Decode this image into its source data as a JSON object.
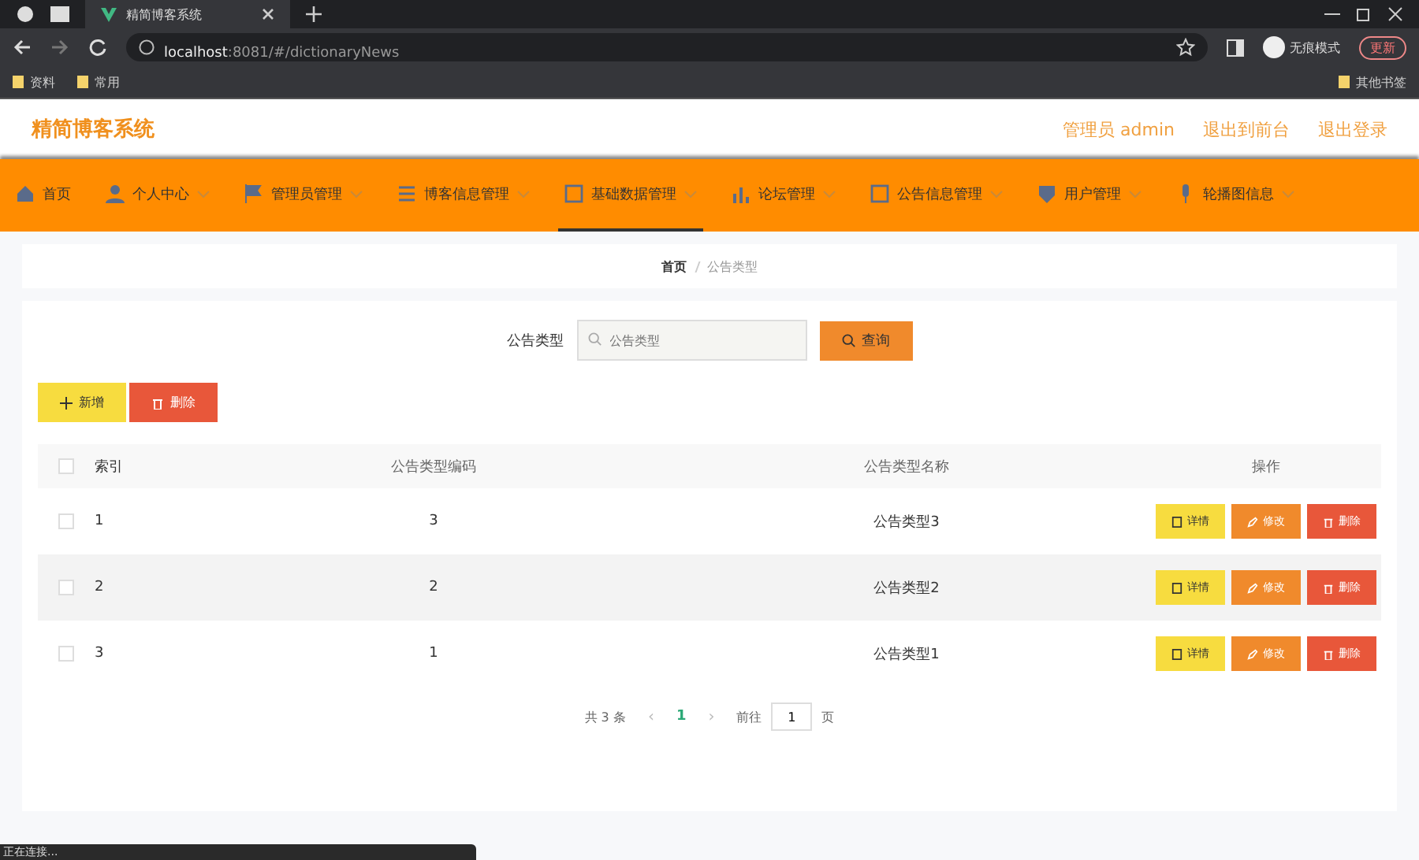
{
  "browser": {
    "tab_title": "精简博客系统",
    "url_host": "localhost",
    "url_path": ":8081/#/dictionaryNews",
    "incognito_label": "无痕模式",
    "update_label": "更新",
    "bookmarks": [
      "资料",
      "常用"
    ],
    "other_bookmarks": "其他书签"
  },
  "header": {
    "title": "精简博客系统",
    "links": [
      "管理员 admin",
      "退出到前台",
      "退出登录"
    ]
  },
  "nav": [
    {
      "label": "首页",
      "selected": false,
      "expandable": false
    },
    {
      "label": "个人中心",
      "selected": false,
      "expandable": true
    },
    {
      "label": "管理员管理",
      "selected": false,
      "expandable": true
    },
    {
      "label": "博客信息管理",
      "selected": false,
      "expandable": true
    },
    {
      "label": "基础数据管理",
      "selected": true,
      "expandable": true
    },
    {
      "label": "论坛管理",
      "selected": false,
      "expandable": true
    },
    {
      "label": "公告信息管理",
      "selected": false,
      "expandable": true
    },
    {
      "label": "用户管理",
      "selected": false,
      "expandable": true
    },
    {
      "label": "轮播图信息",
      "selected": false,
      "expandable": true
    }
  ],
  "breadcrumb": [
    "首页",
    "公告类型"
  ],
  "search": {
    "label": "公告类型",
    "placeholder": "公告类型",
    "button": "查询"
  },
  "actions": [
    {
      "label": "新增",
      "kind": "add"
    },
    {
      "label": "删除",
      "kind": "delete"
    }
  ],
  "table": {
    "select_all_checked": false,
    "columns": [
      "索引",
      "公告类型编码",
      "公告类型名称",
      "操作"
    ],
    "rows": [
      {
        "checked": false,
        "index": "1",
        "code": "3",
        "name": "公告类型3",
        "buttons": [
          {
            "label": "详情",
            "kind": "detail"
          },
          {
            "label": "修改",
            "kind": "edit"
          },
          {
            "label": "删除",
            "kind": "delete"
          }
        ]
      },
      {
        "checked": false,
        "index": "2",
        "code": "2",
        "name": "公告类型2",
        "buttons": [
          {
            "label": "详情",
            "kind": "detail"
          },
          {
            "label": "修改",
            "kind": "edit"
          },
          {
            "label": "删除",
            "kind": "delete"
          }
        ]
      },
      {
        "checked": false,
        "index": "3",
        "code": "1",
        "name": "公告类型1",
        "buttons": [
          {
            "label": "详情",
            "kind": "detail"
          },
          {
            "label": "修改",
            "kind": "edit"
          },
          {
            "label": "删除",
            "kind": "delete"
          }
        ]
      }
    ]
  },
  "pagination": {
    "total": "共 3 条",
    "prev": "‹",
    "pages": [
      {
        "label": "1",
        "selected": true
      }
    ],
    "next": "›",
    "goto_label": "前往",
    "goto_value": "1",
    "goto_suffix": "页"
  },
  "status_bar": "正在连接..."
}
